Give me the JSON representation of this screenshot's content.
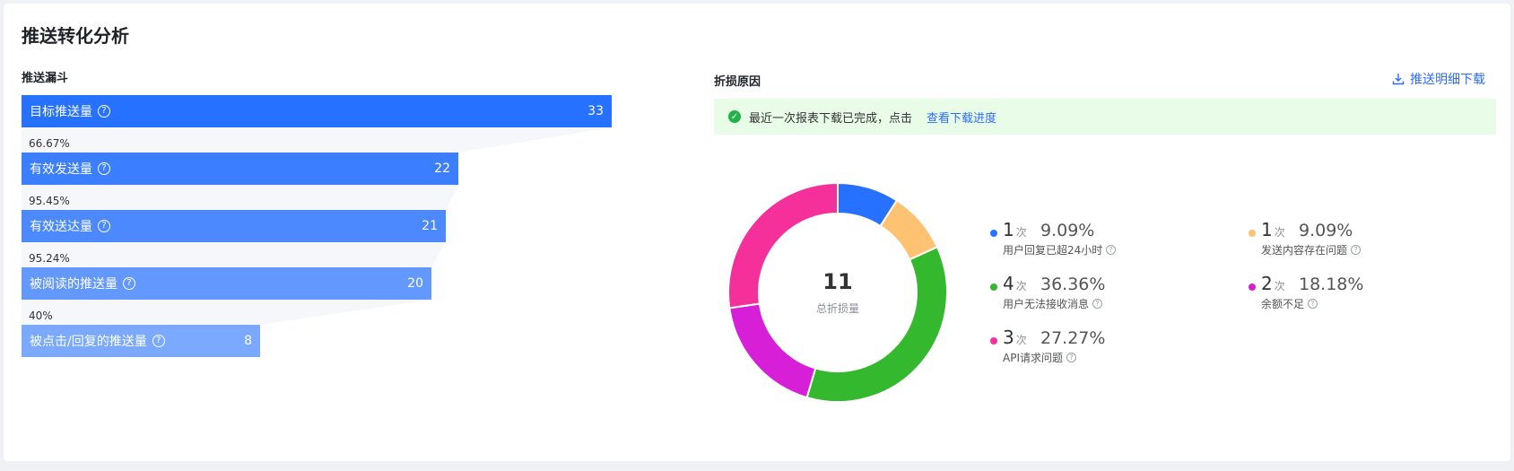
{
  "page": {
    "title": "推送转化分析"
  },
  "funnel": {
    "heading": "推送漏斗",
    "stages": [
      {
        "label": "目标推送量",
        "value": "33",
        "color": "#2671ff"
      },
      {
        "label": "有效发送量",
        "value": "22",
        "color": "#3b7eff"
      },
      {
        "label": "有效送达量",
        "value": "21",
        "color": "#4c89ff"
      },
      {
        "label": "被阅读的推送量",
        "value": "20",
        "color": "#6399ff"
      },
      {
        "label": "被点击/回复的推送量",
        "value": "8",
        "color": "#7aa9ff"
      }
    ],
    "rates": [
      "66.67%",
      "95.45%",
      "95.24%",
      "40%"
    ]
  },
  "loss": {
    "heading": "折损原因",
    "download_label": "推送明细下载",
    "notice_text": "最近一次报表下载已完成，点击",
    "notice_link": "查看下载进度",
    "total": "11",
    "total_label": "总折损量",
    "unit": "次",
    "items": [
      {
        "count": "1",
        "pct": "9.09%",
        "label": "用户回复已超24小时",
        "color": "#2671ff"
      },
      {
        "count": "1",
        "pct": "9.09%",
        "label": "发送内容存在问题",
        "color": "#fdc373"
      },
      {
        "count": "4",
        "pct": "36.36%",
        "label": "用户无法接收消息",
        "color": "#33b82e"
      },
      {
        "count": "2",
        "pct": "18.18%",
        "label": "余额不足",
        "color": "#d61fd6"
      },
      {
        "count": "3",
        "pct": "27.27%",
        "label": "API请求问题",
        "color": "#f5309a"
      }
    ]
  }
}
